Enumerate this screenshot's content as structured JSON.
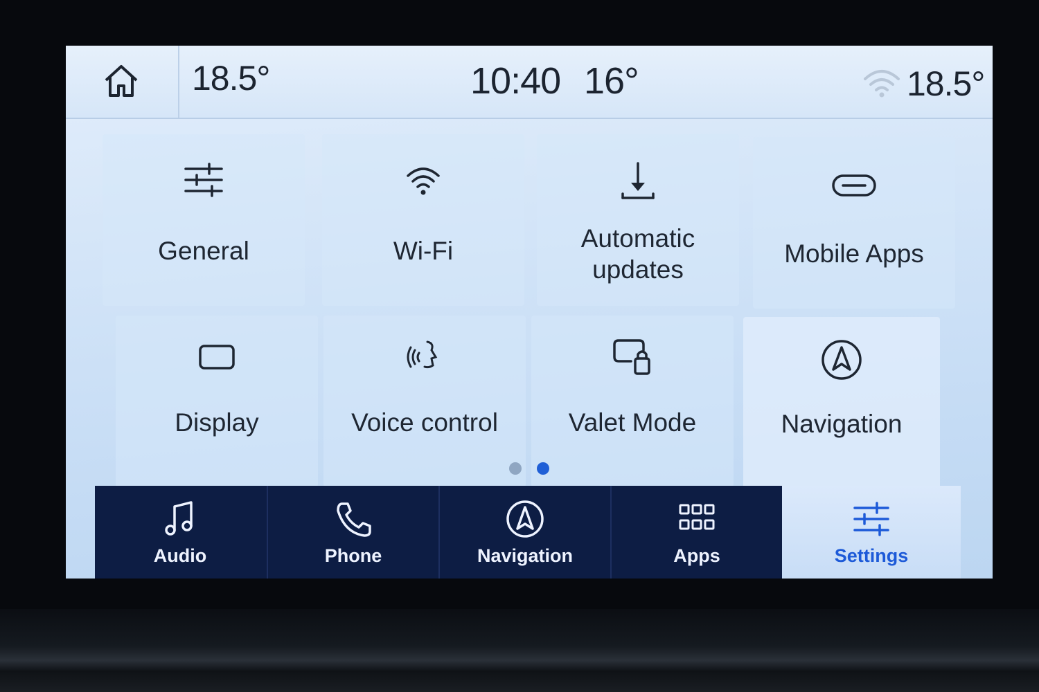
{
  "status": {
    "driver_temp": "18.5°",
    "time": "10:40",
    "outside_temp": "16°",
    "passenger_temp": "18.5°"
  },
  "settings_tiles": [
    {
      "label": "General",
      "icon": "sliders-icon"
    },
    {
      "label": "Wi-Fi",
      "icon": "wifi-icon"
    },
    {
      "label": "Automatic updates",
      "label_line1": "Automatic",
      "label_line2": "updates",
      "icon": "download-icon"
    },
    {
      "label": "Mobile Apps",
      "icon": "link-pill-icon"
    },
    {
      "label": "Display",
      "icon": "display-icon"
    },
    {
      "label": "Voice control",
      "icon": "voice-icon"
    },
    {
      "label": "Valet Mode",
      "icon": "valet-lock-icon"
    },
    {
      "label": "Navigation",
      "icon": "navigation-arrow-icon"
    }
  ],
  "pager": {
    "pages": 2,
    "current": 2
  },
  "navbar": [
    {
      "label": "Audio",
      "icon": "music-note-icon",
      "active": false
    },
    {
      "label": "Phone",
      "icon": "phone-icon",
      "active": false
    },
    {
      "label": "Navigation",
      "icon": "navigation-arrow-icon",
      "active": false
    },
    {
      "label": "Apps",
      "icon": "grid-icon",
      "active": false
    },
    {
      "label": "Settings",
      "icon": "sliders-icon",
      "active": true
    }
  ],
  "colors": {
    "screen_bg": "#cfe2f7",
    "navbar_bg": "#0d1d44",
    "active_accent": "#1d5ad8",
    "text_dark": "#1e2632"
  }
}
